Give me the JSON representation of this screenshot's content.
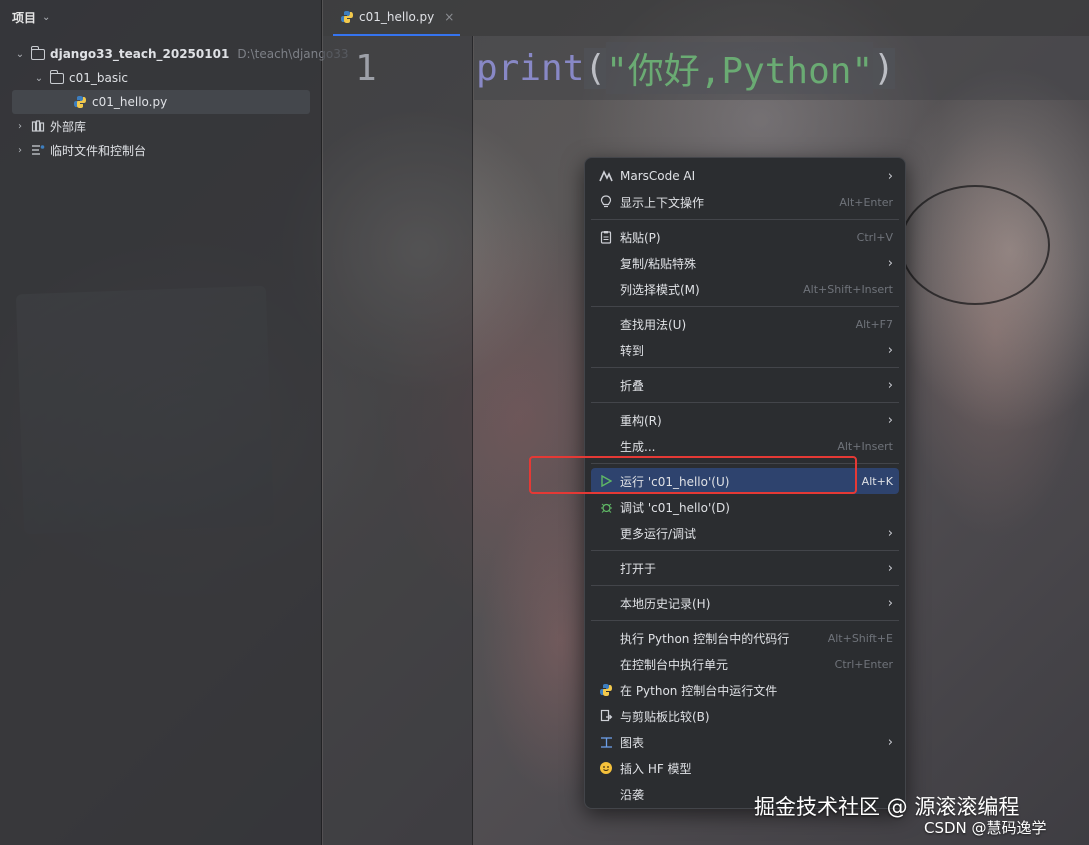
{
  "project_panel": {
    "title": "项目",
    "tree": [
      {
        "label": "django33_teach_20250101",
        "suffix": "D:\\teach\\django33"
      },
      {
        "label": "c01_basic"
      },
      {
        "label": "c01_hello.py"
      },
      {
        "label": "外部库"
      },
      {
        "label": "临时文件和控制台"
      }
    ]
  },
  "editor": {
    "tab_label": "c01_hello.py",
    "line_number": "1",
    "code": {
      "fn": "print",
      "open": "(",
      "str": "\"你好,Python\"",
      "close": ")"
    }
  },
  "context_menu": {
    "items": [
      {
        "label": "MarsCode AI",
        "shortcut": "",
        "icon": "marscode-icon",
        "submenu": true
      },
      {
        "label": "显示上下文操作",
        "shortcut": "Alt+Enter",
        "icon": "lightbulb-icon"
      },
      {
        "label": "粘贴(P)",
        "shortcut": "Ctrl+V",
        "icon": "clipboard-icon"
      },
      {
        "label": "复制/粘贴特殊",
        "shortcut": "",
        "submenu": true
      },
      {
        "label": "列选择模式(M)",
        "shortcut": "Alt+Shift+Insert"
      },
      {
        "label": "查找用法(U)",
        "shortcut": "Alt+F7"
      },
      {
        "label": "转到",
        "shortcut": "",
        "submenu": true
      },
      {
        "label": "折叠",
        "shortcut": "",
        "submenu": true
      },
      {
        "label": "重构(R)",
        "shortcut": "",
        "submenu": true
      },
      {
        "label": "生成...",
        "shortcut": "Alt+Insert"
      },
      {
        "label": "运行 'c01_hello'(U)",
        "shortcut": "Alt+K",
        "icon": "run-icon"
      },
      {
        "label": "调试 'c01_hello'(D)",
        "shortcut": "",
        "icon": "debug-icon"
      },
      {
        "label": "更多运行/调试",
        "shortcut": "",
        "submenu": true
      },
      {
        "label": "打开于",
        "shortcut": "",
        "submenu": true
      },
      {
        "label": "本地历史记录(H)",
        "shortcut": "",
        "submenu": true
      },
      {
        "label": "执行 Python 控制台中的代码行",
        "shortcut": "Alt+Shift+E"
      },
      {
        "label": "在控制台中执行单元",
        "shortcut": "Ctrl+Enter"
      },
      {
        "label": "在 Python 控制台中运行文件",
        "shortcut": "",
        "icon": "python-icon"
      },
      {
        "label": "与剪贴板比较(B)",
        "shortcut": "",
        "icon": "compare-icon"
      },
      {
        "label": "图表",
        "shortcut": "",
        "icon": "diagram-icon",
        "submenu": true
      },
      {
        "label": "插入 HF 模型",
        "shortcut": "",
        "icon": "huggingface-icon"
      },
      {
        "label": "沿袭",
        "shortcut": ""
      }
    ]
  },
  "watermark": {
    "line1": "掘金技术社区 @ 源滚滚编程",
    "line2": "CSDN @慧码逸学"
  },
  "colors": {
    "highlight": "#2e436e",
    "annotation_box": "#e53935",
    "string": "#6aab73",
    "function": "#8888c6"
  }
}
